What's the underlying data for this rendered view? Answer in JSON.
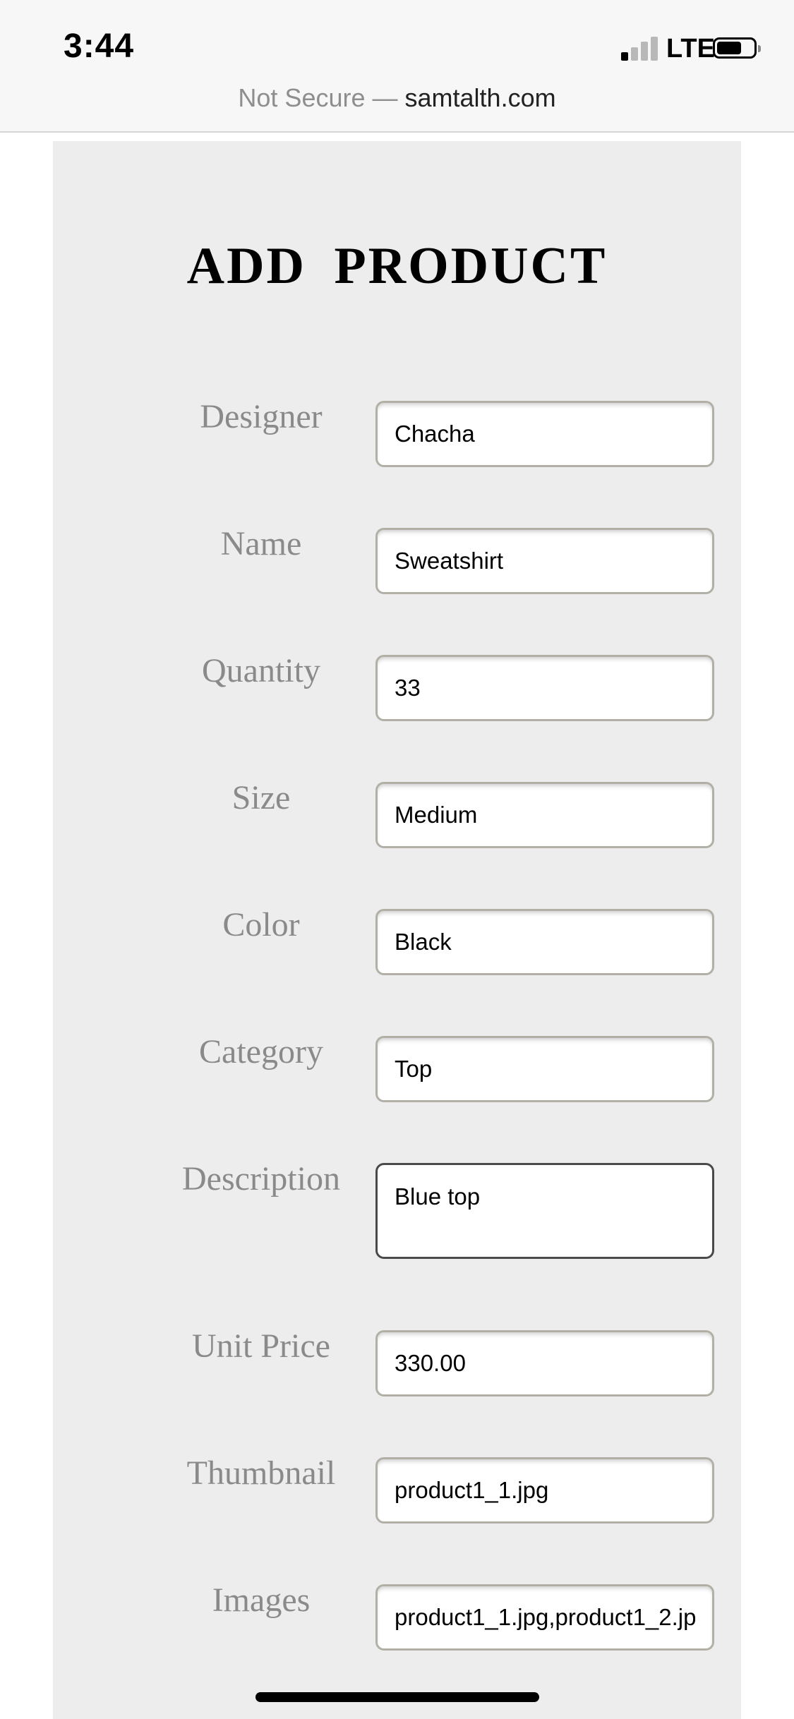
{
  "status_bar": {
    "time": "3:44",
    "network": "LTE",
    "signal_bars_filled": 1,
    "signal_bars_total": 4,
    "battery_icon": "battery-icon"
  },
  "browser": {
    "insecure_label": "Not Secure —",
    "domain": "samtalth.com"
  },
  "form": {
    "title": "ADD PRODUCT",
    "fields": {
      "designer": {
        "label": "Designer",
        "value": "Chacha"
      },
      "name": {
        "label": "Name",
        "value": "Sweatshirt"
      },
      "quantity": {
        "label": "Quantity",
        "value": "33"
      },
      "size": {
        "label": "Size",
        "value": "Medium"
      },
      "color": {
        "label": "Color",
        "value": "Black"
      },
      "category": {
        "label": "Category",
        "value": "Top"
      },
      "description": {
        "label": "Description",
        "value": "Blue top"
      },
      "unit_price": {
        "label": "Unit Price",
        "value": "330.00"
      },
      "thumbnail": {
        "label": "Thumbnail",
        "value": "product1_1.jpg"
      },
      "images": {
        "label": "Images",
        "value": "product1_1.jpg,product1_2.jp"
      }
    }
  },
  "colors": {
    "panel_background": "#ededed",
    "label_gray": "#8a8a8a",
    "input_border": "#b2b0a6",
    "focused_border": "#4a4a4a"
  }
}
